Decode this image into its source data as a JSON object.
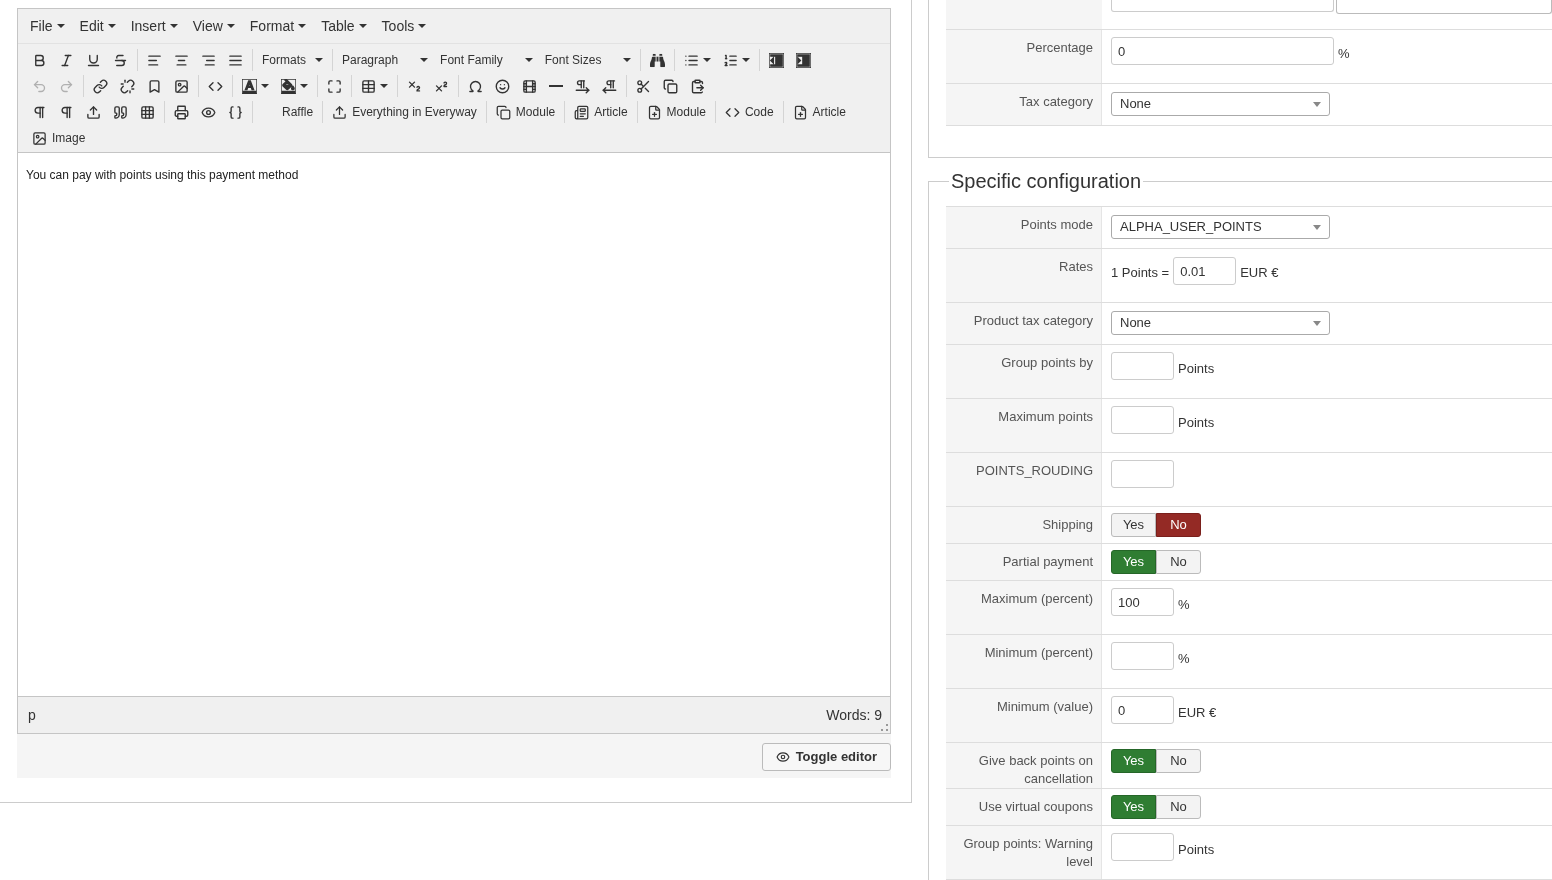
{
  "editor": {
    "menubar": [
      "File",
      "Edit",
      "Insert",
      "View",
      "Format",
      "Table",
      "Tools"
    ],
    "toolbar_labels": {
      "formats": "Formats",
      "block": "Paragraph",
      "font_family": "Font Family",
      "font_sizes": "Font Sizes",
      "raffle": "Raffle",
      "everything": "Everything in Everyway",
      "module_1": "Module",
      "article_1": "Article",
      "module_2": "Module",
      "code": "Code",
      "article_2": "Article",
      "image": "Image"
    },
    "undo": {
      "disabled": true
    },
    "redo": {
      "disabled": true
    },
    "content": "You can pay with points using this payment method",
    "path": "p",
    "word_count": "Words: 9",
    "toggle_button": "Toggle editor"
  },
  "general_rows": [
    {
      "kind": "text",
      "label": "Percentage",
      "value": "0",
      "suffix": "%",
      "wide": true
    },
    {
      "kind": "select",
      "label": "Tax category",
      "value": "None"
    }
  ],
  "specific": {
    "legend": "Specific configuration",
    "rows": [
      {
        "kind": "select",
        "label": "Points mode",
        "value": "ALPHA_USER_POINTS"
      },
      {
        "kind": "rates",
        "label": "Rates",
        "prefix": "1 Points =",
        "value": "0.01",
        "suffix": "EUR €"
      },
      {
        "kind": "select",
        "label": "Product tax category",
        "value": "None"
      },
      {
        "kind": "text",
        "label": "Group points by",
        "value": "",
        "suffix": "Points"
      },
      {
        "kind": "text",
        "label": "Maximum points",
        "value": "",
        "suffix": "Points"
      },
      {
        "kind": "text",
        "label": "POINTS_ROUDING",
        "value": ""
      },
      {
        "kind": "toggle",
        "label": "Shipping",
        "options": [
          {
            "label": "Yes",
            "selected": false
          },
          {
            "label": "No",
            "selected": true
          }
        ]
      },
      {
        "kind": "toggle",
        "label": "Partial payment",
        "options": [
          {
            "label": "Yes",
            "selected": true
          },
          {
            "label": "No",
            "selected": false
          }
        ]
      },
      {
        "kind": "text",
        "label": "Maximum (percent)",
        "value": "100",
        "suffix": "%"
      },
      {
        "kind": "text",
        "label": "Minimum (percent)",
        "value": "",
        "suffix": "%"
      },
      {
        "kind": "text",
        "label": "Minimum (value)",
        "value": "0",
        "suffix": "EUR €"
      },
      {
        "kind": "toggle",
        "label": "Give back points on cancellation",
        "options": [
          {
            "label": "Yes",
            "selected": true
          },
          {
            "label": "No",
            "selected": false
          }
        ]
      },
      {
        "kind": "toggle",
        "label": "Use virtual coupons",
        "options": [
          {
            "label": "Yes",
            "selected": true
          },
          {
            "label": "No",
            "selected": false
          }
        ]
      },
      {
        "kind": "text",
        "label": "Group points: Warning level",
        "value": "",
        "suffix": "Points"
      }
    ]
  }
}
